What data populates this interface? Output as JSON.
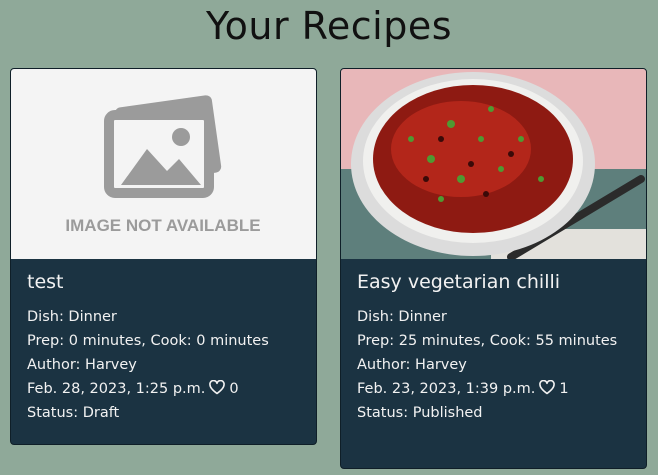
{
  "page": {
    "title": "Your Recipes"
  },
  "recipes": [
    {
      "image": "image-not-available",
      "image_text": "IMAGE NOT AVAILABLE",
      "title": "test",
      "dish": "Dish: Dinner",
      "times": "Prep: 0 minutes, Cook: 0 minutes",
      "author": "Author: Harvey",
      "date": "Feb. 28, 2023, 1:25 p.m.",
      "likes": "0",
      "status": "Status: Draft"
    },
    {
      "image": "vegetarian-chilli-photo",
      "title": "Easy vegetarian chilli",
      "dish": "Dish: Dinner",
      "times": "Prep: 25 minutes, Cook: 55 minutes",
      "author": "Author: Harvey",
      "date": "Feb. 23, 2023, 1:39 p.m.",
      "likes": "1",
      "status": "Status: Published"
    }
  ],
  "colors": {
    "background": "#8fa999",
    "card": "#1b3342",
    "text": "#f2f2f2"
  }
}
